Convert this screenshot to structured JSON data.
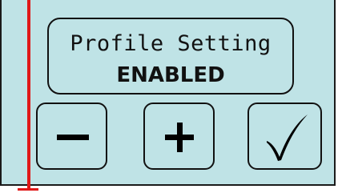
{
  "status": {
    "title": "Profile Setting",
    "value": "ENABLED"
  },
  "controls": {
    "minus": {
      "icon": "minus-icon",
      "symbol": "−"
    },
    "plus": {
      "icon": "plus-icon",
      "symbol": "+"
    },
    "confirm": {
      "icon": "checkmark-icon",
      "symbol": "✓"
    }
  },
  "colors": {
    "screen_background": "#bfe3e6",
    "outline": "#111111",
    "marker_line": "#e01818"
  }
}
